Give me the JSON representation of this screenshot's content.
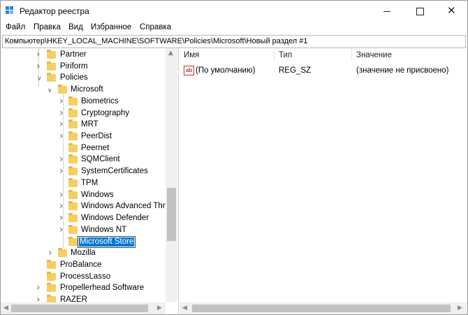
{
  "window": {
    "title": "Редактор реестра"
  },
  "menu": [
    "Файл",
    "Правка",
    "Вид",
    "Избранное",
    "Справка"
  ],
  "address": "Компьютер\\HKEY_LOCAL_MACHINE\\SOFTWARE\\Policies\\Microsoft\\Новый раздел #1",
  "tree": {
    "items": [
      {
        "label": "Partner"
      },
      {
        "label": "Piriform"
      },
      {
        "label": "Policies"
      },
      {
        "label": "Microsoft"
      },
      {
        "label": "Biometrics"
      },
      {
        "label": "Cryptography"
      },
      {
        "label": "MRT"
      },
      {
        "label": "PeerDist"
      },
      {
        "label": "Peernet"
      },
      {
        "label": "SQMClient"
      },
      {
        "label": "SystemCertificates"
      },
      {
        "label": "TPM"
      },
      {
        "label": "Windows"
      },
      {
        "label": "Windows Advanced Thre"
      },
      {
        "label": "Windows Defender"
      },
      {
        "label": "Windows NT"
      },
      {
        "label": "Microsoft Store"
      },
      {
        "label": "Mozilla"
      },
      {
        "label": "ProBalance"
      },
      {
        "label": "ProcessLasso"
      },
      {
        "label": "Propellerhead Software"
      },
      {
        "label": "RAZER"
      }
    ]
  },
  "list": {
    "columns": {
      "name": "Имя",
      "type": "Тип",
      "value": "Значение"
    },
    "rows": [
      {
        "icon": "ab",
        "name": "(По умолчанию)",
        "type": "REG_SZ",
        "value": "(значение не присвоено)"
      }
    ]
  },
  "colors": {
    "selection": "#0078d7",
    "folder": "#f5cf64"
  }
}
